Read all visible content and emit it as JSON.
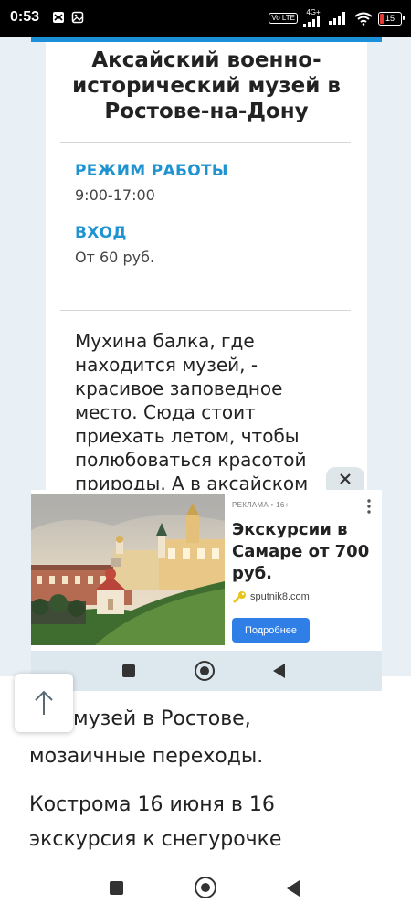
{
  "status_bar": {
    "time": "0:53",
    "network": "4G+",
    "volte": "Vo LTE",
    "battery": "15",
    "colors": {
      "background": "#000000",
      "battery_low": "#e53935"
    }
  },
  "article": {
    "title": "Аксайский военно-исторический музей в Ростове-на-Дону",
    "hours_label": "РЕЖИМ РАБОТЫ",
    "hours_value": "9:00-17:00",
    "entry_label": "ВХОД",
    "entry_value": "От 60 руб.",
    "description": "Мухина балка, где находится музей, - красивое заповедное место. Сюда стоит приехать летом, чтобы полюбоваться красотой природы. А в аксайском",
    "accent_color": "#1f93d0"
  },
  "ad": {
    "tag": "РЕКЛАМА • 16+",
    "headline": "Экскурсии в Самаре от 700 руб.",
    "site": "sputnik8.com",
    "cta": "Подробнее",
    "cta_color": "#2f7fe6"
  },
  "lower_text": {
    "line1": "музей в Ростове,",
    "line2": "мозаичные переходы.",
    "line3": "Кострома 16 июня в 16",
    "line4": "экскурсия к снегурочке"
  },
  "icons": [
    "close-icon",
    "more-vert-icon",
    "scroll-top-arrow-icon",
    "recent-apps-icon",
    "home-icon",
    "back-icon",
    "wifi-icon",
    "signal-icon",
    "key-icon"
  ]
}
